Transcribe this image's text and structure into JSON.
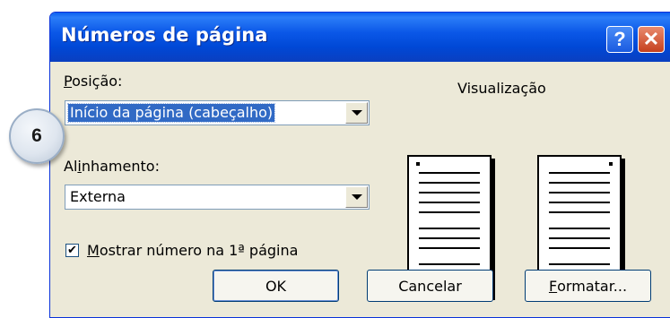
{
  "step_badge": "6",
  "dialog": {
    "title": "Números de página",
    "help_glyph": "?",
    "close_glyph": "✕"
  },
  "position": {
    "label_first": "P",
    "label_rest": "osição:",
    "selected": "Início da página (cabeçalho)"
  },
  "alignment": {
    "label_first": "Al",
    "label_key": "i",
    "label_rest": "nhamento:",
    "selected": "Externa"
  },
  "show_on_first": {
    "checked": true,
    "mark": "✔",
    "label_key": "M",
    "label_rest": "ostrar número na 1ª página"
  },
  "preview": {
    "label": "Visualização"
  },
  "buttons": {
    "ok": "OK",
    "cancel": "Cancelar",
    "format_key": "F",
    "format_rest": "ormatar..."
  }
}
